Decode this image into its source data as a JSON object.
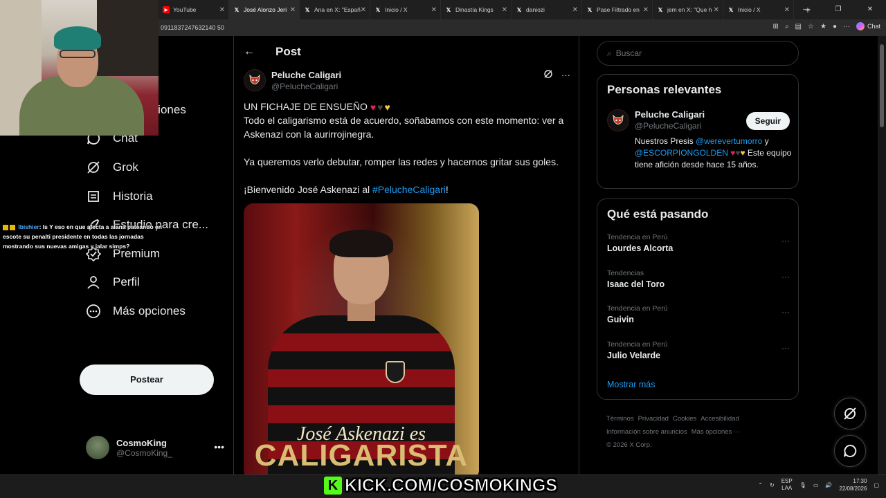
{
  "browser": {
    "tabs": [
      {
        "title": "YouTube",
        "icon": "youtube-icon",
        "active": false
      },
      {
        "title": "José Alonzo Jerí",
        "icon": "x-icon",
        "active": true
      },
      {
        "title": "Ana en X: \"Españ",
        "icon": "x-icon",
        "active": false
      },
      {
        "title": "Inicio / X",
        "icon": "x-icon",
        "active": false
      },
      {
        "title": "Dinastía Kings",
        "icon": "x-icon",
        "active": false
      },
      {
        "title": "daniozi",
        "icon": "x-icon",
        "active": false
      },
      {
        "title": "Pase Filtrado en",
        "icon": "x-icon",
        "active": false
      },
      {
        "title": "jem en X: \"Que h",
        "icon": "x-icon",
        "active": false
      },
      {
        "title": "Inicio / X",
        "icon": "x-icon",
        "active": false
      }
    ],
    "url_fragment": "0911837247632140 50",
    "chat_label": "Chat"
  },
  "nav": {
    "items": [
      {
        "label": "Notificaciones",
        "icon": "bell-icon"
      },
      {
        "label": "Chat",
        "icon": "chat-bubble-icon"
      },
      {
        "label": "Grok",
        "icon": "grok-icon"
      },
      {
        "label": "Historia",
        "icon": "list-icon"
      },
      {
        "label": "Estudio para cre...",
        "icon": "rocket-icon"
      },
      {
        "label": "Premium",
        "icon": "verified-badge-icon"
      },
      {
        "label": "Perfil",
        "icon": "person-icon"
      },
      {
        "label": "Más opciones",
        "icon": "more-circle-icon"
      }
    ],
    "post_button": "Postear",
    "account": {
      "name": "CosmoKing",
      "handle": "@CosmoKing_"
    }
  },
  "post": {
    "header_title": "Post",
    "author_name": "Peluche Caligari",
    "author_handle": "@PelucheCaligari",
    "line1": "UN FICHAJE DE ENSUEÑO",
    "line2": "Todo el caligarismo está de acuerdo, soñabamos con este momento: ver a Askenazi con la aurirrojinegra.",
    "line3": "Ya queremos verlo debutar, romper las redes y hacernos gritar sus goles.",
    "line4_prefix": "¡Bienvenido José Askenazi al ",
    "line4_hashtag": "#PelucheCaligari",
    "line4_suffix": "!",
    "image_text_1": "José Askenazi es",
    "image_text_2": "CALIGARISTA"
  },
  "sidebar": {
    "search_placeholder": "Buscar",
    "relevant_title": "Personas relevantes",
    "relevant": {
      "name": "Peluche Caligari",
      "handle": "@PelucheCaligari",
      "follow": "Seguir",
      "bio_prefix": "Nuestros Presis ",
      "mention1": "@werevertumorro",
      "bio_and": " y ",
      "mention2": "@ESCORPIONGOLDEN",
      "bio_suffix": " Este equipo tiene afición desde hace 15 años."
    },
    "trends_title": "Qué está pasando",
    "trends": [
      {
        "category": "Tendencia en Perú",
        "name": "Lourdes Alcorta"
      },
      {
        "category": "Tendencias",
        "name": "Isaac del Toro"
      },
      {
        "category": "Tendencia en Perú",
        "name": "Guivin"
      },
      {
        "category": "Tendencia en Perú",
        "name": "Julio Velarde"
      }
    ],
    "show_more": "Mostrar más",
    "footer": [
      "Términos",
      "Privacidad",
      "Cookies",
      "Accesibilidad",
      "Información sobre anuncios",
      "Más opciones ···",
      "© 2026 X Corp."
    ]
  },
  "stream": {
    "chat_user": "Ibishier",
    "chat_message": ": Is Y eso en que afecta a alana pateando en escote su penalti presidente en todas las jornadas mostrando sus nuevas amigas y jalar simps?",
    "kick_label": "KICK.COM/COSMOKINGS"
  },
  "taskbar": {
    "lang_top": "ESP",
    "lang_bottom": "LAA",
    "time": "17:30",
    "date": "22/08/2026"
  },
  "colors": {
    "accent": "#1d9bf0",
    "kick": "#53fc18"
  }
}
